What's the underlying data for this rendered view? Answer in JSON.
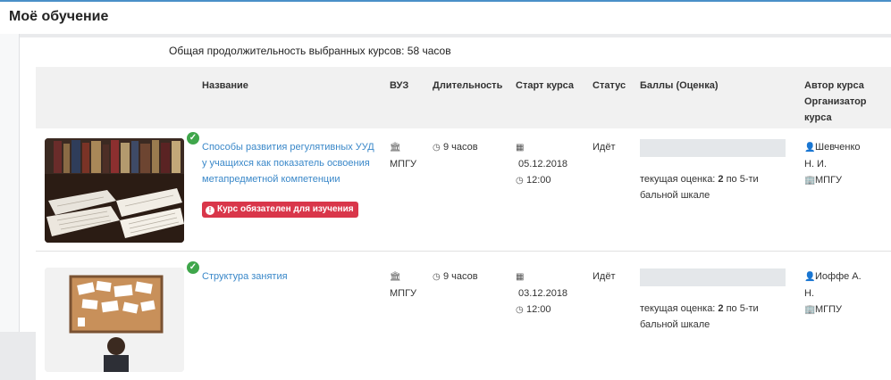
{
  "page": {
    "title": "Моё обучение"
  },
  "summary": {
    "text": "Общая продолжительность выбранных курсов: 58 часов"
  },
  "table": {
    "headers": {
      "name": "Название",
      "university": "ВУЗ",
      "duration": "Длительность",
      "start": "Старт курса",
      "status": "Статус",
      "score": "Баллы (Оценка)",
      "author_line1": "Автор курса",
      "author_line2": "Организатор",
      "author_line3": "курса"
    },
    "rows": [
      {
        "title": "Способы развития регулятивных УУД у учащихся как показатель освоения метапредметной компетенции",
        "badge": "Курс обязателен для изучения",
        "university": "МПГУ",
        "duration": "9 часов",
        "start_date": "05.12.2018",
        "start_time": "12:00",
        "status": "Идёт",
        "grade_prefix": "текущая оценка: ",
        "grade_value": "2",
        "grade_suffix": " по 5-ти бальной шкале",
        "author": "Шевченко Н. И.",
        "organizer": "МПГУ"
      },
      {
        "title": "Структура занятия",
        "university": "МПГУ",
        "duration": "9 часов",
        "start_date": "03.12.2018",
        "start_time": "12:00",
        "status": "Идёт",
        "grade_prefix": "текущая оценка: ",
        "grade_value": "2",
        "grade_suffix": " по 5-ти бальной шкале",
        "author": "Иоффе А. Н.",
        "organizer": "МГПУ"
      }
    ]
  },
  "icons": {
    "check": "check-circle-icon",
    "alert": "exclamation-circle-icon",
    "university": "university-icon",
    "clock": "clock-icon",
    "calendar": "calendar-icon",
    "user": "user-icon",
    "building": "building-icon"
  },
  "colors": {
    "link": "#3a88c9",
    "badge": "#d9364a",
    "check": "#3fa64b",
    "accent": "#4a90c8"
  }
}
